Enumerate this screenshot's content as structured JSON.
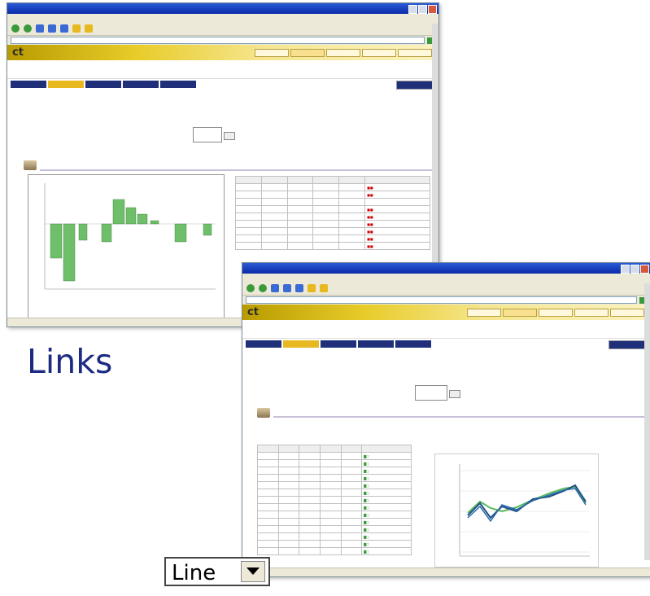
{
  "caption": "Links",
  "chart_type_select": {
    "value": "Line"
  },
  "screenshots": [
    {
      "name": "browser-window-bar-chart"
    },
    {
      "name": "browser-window-line-chart"
    }
  ],
  "colors": {
    "caption": "#1d2a82",
    "titlebar": "#0a2aa8",
    "app_header": "#e8cc2a",
    "nav_tab": "#1f2f7a",
    "nav_tab_active": "#e8b820",
    "bar_fill": "#6fbf6a",
    "line_dark": "#1f4f8a",
    "line_green": "#5aba5a"
  }
}
